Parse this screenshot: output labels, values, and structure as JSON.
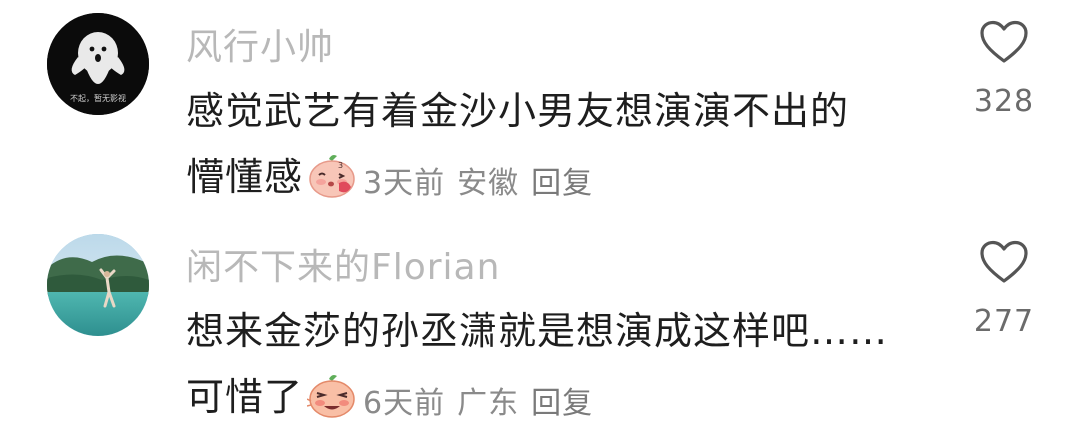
{
  "comments": [
    {
      "username": "风行小帅",
      "line1": "感觉武艺有着金沙小男友想演演不出的",
      "line2": "懵懂感",
      "time": "3天前",
      "location": "安徽",
      "reply_label": "回复",
      "likes": "328",
      "avatar_caption": "不起，暂无影视"
    },
    {
      "username": "闲不下来的Florian",
      "line1": "想来金莎的孙丞潇就是想演成这样吧……",
      "line2": "可惜了",
      "time": "6天前",
      "location": "广东",
      "reply_label": "回复",
      "likes": "277"
    }
  ],
  "colors": {
    "username": "#b8b8b8",
    "text": "#1e1e1e",
    "meta": "#8a8a8a",
    "like_icon": "#555555"
  },
  "icons": [
    "heart-outline-icon",
    "blushing-peach-emoji",
    "embarrassed-peach-emoji"
  ]
}
